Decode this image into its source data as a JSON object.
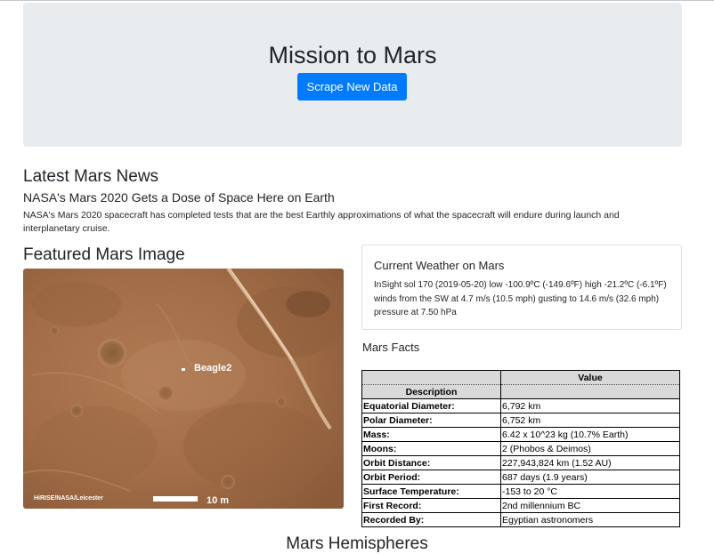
{
  "jumbotron": {
    "title": "Mission to Mars",
    "button_label": "Scrape New Data"
  },
  "news": {
    "section_title": "Latest Mars News",
    "headline": "NASA's Mars 2020 Gets a Dose of Space Here on Earth",
    "body": "NASA's Mars 2020 spacecraft has completed tests that are the best Earthly approximations of what the spacecraft will endure during launch and interplanetary cruise."
  },
  "featured": {
    "section_title": "Featured Mars Image",
    "image_label": "Beagle2",
    "credit": "HiRISE/NASA/Leicester",
    "scale_label": "10 m"
  },
  "weather": {
    "title": "Current Weather on Mars",
    "text": "InSight sol 170 (2019-05-20) low -100.9ºC (-149.6ºF) high -21.2ºC (-6.1ºF) winds from the SW at 4.7 m/s (10.5 mph) gusting to 14.6 m/s (32.6 mph) pressure at 7.50 hPa"
  },
  "facts": {
    "section_title": "Mars Facts",
    "header_value": "Value",
    "header_description": "Description",
    "rows": [
      {
        "label": "Equatorial Diameter:",
        "value": "6,792 km"
      },
      {
        "label": "Polar Diameter:",
        "value": "6,752 km"
      },
      {
        "label": "Mass:",
        "value": "6.42 x 10^23 kg (10.7% Earth)"
      },
      {
        "label": "Moons:",
        "value": "2 (Phobos & Deimos)"
      },
      {
        "label": "Orbit Distance:",
        "value": "227,943,824 km (1.52 AU)"
      },
      {
        "label": "Orbit Period:",
        "value": "687 days (1.9 years)"
      },
      {
        "label": "Surface Temperature:",
        "value": "-153 to 20 °C"
      },
      {
        "label": "First Record:",
        "value": "2nd millennium BC"
      },
      {
        "label": "Recorded By:",
        "value": "Egyptian astronomers"
      }
    ]
  },
  "hemispheres": {
    "section_title": "Mars Hemispheres"
  },
  "colors": {
    "primary": "#007bff",
    "jumbotron_bg": "#e9ecef",
    "table_header_bg": "#d9d9d9"
  }
}
